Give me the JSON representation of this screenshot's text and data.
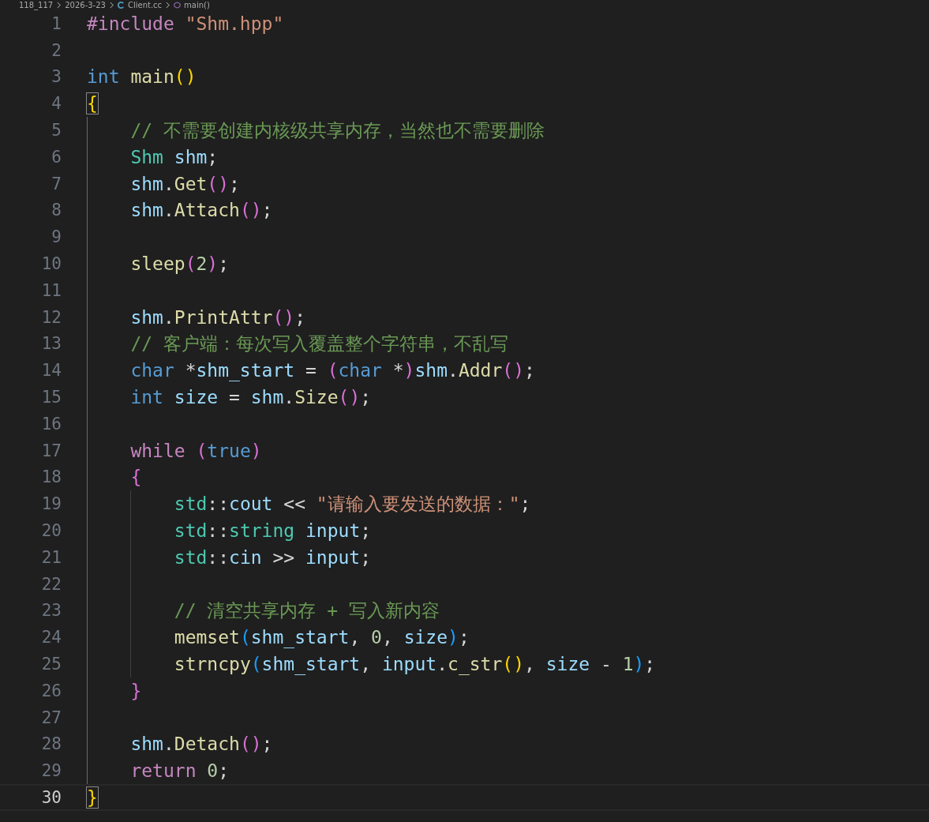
{
  "breadcrumb": {
    "items": [
      {
        "text": "118_117",
        "kind": "folder"
      },
      {
        "text": "2026-3-23",
        "kind": "folder"
      },
      {
        "text": "Client.cc",
        "kind": "file"
      },
      {
        "text": "main()",
        "kind": "symbol"
      }
    ]
  },
  "editor": {
    "lines": [
      {
        "number": "1",
        "current": false,
        "kind": "top",
        "tokens": [
          {
            "text": "#include",
            "kind": "kw"
          },
          {
            "text": " \"Shm.hpp\"",
            "kind": "str"
          }
        ]
      },
      {
        "number": "2",
        "current": false
      },
      {
        "number": "3",
        "current": false,
        "kind": "top",
        "tokens": [
          {
            "text": "int",
            "kind": "type"
          },
          {
            "text": " main",
            "kind": "fn"
          },
          {
            "text": "(",
            "kind": "br1"
          },
          {
            "text": ")",
            "kind": "br1"
          }
        ]
      },
      {
        "number": "4",
        "current": false,
        "kind": "top",
        "tokens": [
          {
            "text": "{",
            "kind": "match"
          }
        ]
      },
      {
        "number": "5",
        "current": false,
        "kind": "block",
        "tokens": [
          {
            "text": "// 不需要创建内核级共享内存，当然也不需要删除",
            "kind": "com"
          }
        ]
      },
      {
        "number": "6",
        "current": false,
        "kind": "block",
        "tokens": [
          {
            "text": "Shm",
            "kind": "cls"
          },
          {
            "text": " shm",
            "kind": "var"
          },
          {
            "text": ";",
            "kind": "op"
          }
        ]
      },
      {
        "number": "7",
        "current": false,
        "kind": "block",
        "tokens": [
          {
            "text": "shm",
            "kind": "var"
          },
          {
            "text": ".",
            "kind": "op"
          },
          {
            "text": "Get",
            "kind": "fn"
          },
          {
            "text": "(",
            "kind": "br2"
          },
          {
            "text": ")",
            "kind": "br2"
          },
          {
            "text": ";",
            "kind": "op"
          }
        ]
      },
      {
        "number": "8",
        "current": false,
        "kind": "block",
        "tokens": [
          {
            "text": "shm",
            "kind": "var"
          },
          {
            "text": ".",
            "kind": "op"
          },
          {
            "text": "Attach",
            "kind": "fn"
          },
          {
            "text": "(",
            "kind": "br2"
          },
          {
            "text": ")",
            "kind": "br2"
          },
          {
            "text": ";",
            "kind": "op"
          }
        ]
      },
      {
        "number": "9",
        "current": false
      },
      {
        "number": "10",
        "current": false,
        "kind": "block",
        "tokens": [
          {
            "text": "sleep",
            "kind": "fn"
          },
          {
            "text": "(",
            "kind": "br2"
          },
          {
            "text": "2",
            "kind": "num"
          },
          {
            "text": ")",
            "kind": "br2"
          },
          {
            "text": ";",
            "kind": "op"
          }
        ]
      },
      {
        "number": "11",
        "current": false
      },
      {
        "number": "12",
        "current": false,
        "kind": "block",
        "tokens": [
          {
            "text": "shm",
            "kind": "var"
          },
          {
            "text": ".",
            "kind": "op"
          },
          {
            "text": "PrintAttr",
            "kind": "fn"
          },
          {
            "text": "(",
            "kind": "br2"
          },
          {
            "text": ")",
            "kind": "br2"
          },
          {
            "text": ";",
            "kind": "op"
          }
        ]
      },
      {
        "number": "13",
        "current": false,
        "kind": "block",
        "tokens": [
          {
            "text": "// 客户端：每次写入覆盖整个字符串，不乱写",
            "kind": "com"
          }
        ]
      },
      {
        "number": "14",
        "current": false,
        "kind": "block",
        "tokens": [
          {
            "text": "char",
            "kind": "type"
          },
          {
            "text": " *",
            "kind": "op"
          },
          {
            "text": "shm_start",
            "kind": "var"
          },
          {
            "text": " = ",
            "kind": "op"
          },
          {
            "text": "(",
            "kind": "br2"
          },
          {
            "text": "char",
            "kind": "type"
          },
          {
            "text": " *",
            "kind": "op"
          },
          {
            "text": ")",
            "kind": "br2"
          },
          {
            "text": "shm",
            "kind": "var"
          },
          {
            "text": ".",
            "kind": "op"
          },
          {
            "text": "Addr",
            "kind": "fn"
          },
          {
            "text": "(",
            "kind": "br2"
          },
          {
            "text": ")",
            "kind": "br2"
          },
          {
            "text": ";",
            "kind": "op"
          }
        ]
      },
      {
        "number": "15",
        "current": false,
        "kind": "block",
        "tokens": [
          {
            "text": "int",
            "kind": "type"
          },
          {
            "text": " size",
            "kind": "var"
          },
          {
            "text": " = ",
            "kind": "op"
          },
          {
            "text": "shm",
            "kind": "var"
          },
          {
            "text": ".",
            "kind": "op"
          },
          {
            "text": "Size",
            "kind": "fn"
          },
          {
            "text": "(",
            "kind": "br2"
          },
          {
            "text": ")",
            "kind": "br2"
          },
          {
            "text": ";",
            "kind": "op"
          }
        ]
      },
      {
        "number": "16",
        "current": false
      },
      {
        "number": "17",
        "current": false,
        "kind": "block",
        "tokens": [
          {
            "text": "while",
            "kind": "kw"
          },
          {
            "text": " (",
            "kind": "br2"
          },
          {
            "text": "true",
            "kind": "type"
          },
          {
            "text": ")",
            "kind": "br2"
          }
        ]
      },
      {
        "number": "18",
        "current": false,
        "kind": "block",
        "tokens": [
          {
            "text": "{",
            "kind": "br2"
          }
        ]
      },
      {
        "number": "19",
        "current": false,
        "kind": "nested",
        "tokens": [
          {
            "text": "std",
            "kind": "cls"
          },
          {
            "text": "::",
            "kind": "op"
          },
          {
            "text": "cout",
            "kind": "var"
          },
          {
            "text": " << ",
            "kind": "op"
          },
          {
            "text": "\"请输入要发送的数据：\"",
            "kind": "str"
          },
          {
            "text": ";",
            "kind": "op"
          }
        ]
      },
      {
        "number": "20",
        "current": false,
        "kind": "nested",
        "tokens": [
          {
            "text": "std",
            "kind": "cls"
          },
          {
            "text": "::",
            "kind": "op"
          },
          {
            "text": "string",
            "kind": "cls"
          },
          {
            "text": " input",
            "kind": "var"
          },
          {
            "text": ";",
            "kind": "op"
          }
        ]
      },
      {
        "number": "21",
        "current": false,
        "kind": "nested",
        "tokens": [
          {
            "text": "std",
            "kind": "cls"
          },
          {
            "text": "::",
            "kind": "op"
          },
          {
            "text": "cin",
            "kind": "var"
          },
          {
            "text": " >> ",
            "kind": "op"
          },
          {
            "text": "input",
            "kind": "var"
          },
          {
            "text": ";",
            "kind": "op"
          }
        ]
      },
      {
        "number": "22",
        "current": false
      },
      {
        "number": "23",
        "current": false,
        "kind": "nested",
        "tokens": [
          {
            "text": "// 清空共享内存 + 写入新内容",
            "kind": "com"
          }
        ]
      },
      {
        "number": "24",
        "current": false,
        "kind": "nested",
        "tokens": [
          {
            "text": "memset",
            "kind": "fn"
          },
          {
            "text": "(",
            "kind": "br3"
          },
          {
            "text": "shm_start",
            "kind": "var"
          },
          {
            "text": ", ",
            "kind": "op"
          },
          {
            "text": "0",
            "kind": "num"
          },
          {
            "text": ", ",
            "kind": "op"
          },
          {
            "text": "size",
            "kind": "var"
          },
          {
            "text": ")",
            "kind": "br3"
          },
          {
            "text": ";",
            "kind": "op"
          }
        ]
      },
      {
        "number": "25",
        "current": false,
        "kind": "nested",
        "tokens": [
          {
            "text": "strncpy",
            "kind": "fn"
          },
          {
            "text": "(",
            "kind": "br3"
          },
          {
            "text": "shm_start",
            "kind": "var"
          },
          {
            "text": ", ",
            "kind": "op"
          },
          {
            "text": "input",
            "kind": "var"
          },
          {
            "text": ".",
            "kind": "op"
          },
          {
            "text": "c_str",
            "kind": "fn"
          },
          {
            "text": "(",
            "kind": "br1"
          },
          {
            "text": ")",
            "kind": "br1"
          },
          {
            "text": ", ",
            "kind": "op"
          },
          {
            "text": "size",
            "kind": "var"
          },
          {
            "text": " - ",
            "kind": "op"
          },
          {
            "text": "1",
            "kind": "num"
          },
          {
            "text": ")",
            "kind": "br3"
          },
          {
            "text": ";",
            "kind": "op"
          }
        ]
      },
      {
        "number": "26",
        "current": false,
        "kind": "block",
        "tokens": [
          {
            "text": "}",
            "kind": "br2"
          }
        ]
      },
      {
        "number": "27",
        "current": false
      },
      {
        "number": "28",
        "current": false,
        "kind": "block",
        "tokens": [
          {
            "text": "shm",
            "kind": "var"
          },
          {
            "text": ".",
            "kind": "op"
          },
          {
            "text": "Detach",
            "kind": "fn"
          },
          {
            "text": "(",
            "kind": "br2"
          },
          {
            "text": ")",
            "kind": "br2"
          },
          {
            "text": ";",
            "kind": "op"
          }
        ]
      },
      {
        "number": "29",
        "current": false,
        "kind": "block",
        "tokens": [
          {
            "text": "return",
            "kind": "kw"
          },
          {
            "text": " 0",
            "kind": "num"
          },
          {
            "text": ";",
            "kind": "op"
          }
        ]
      },
      {
        "number": "30",
        "current": true,
        "kind": "top",
        "tokens": [
          {
            "text": "}",
            "kind": "match"
          }
        ]
      }
    ]
  }
}
